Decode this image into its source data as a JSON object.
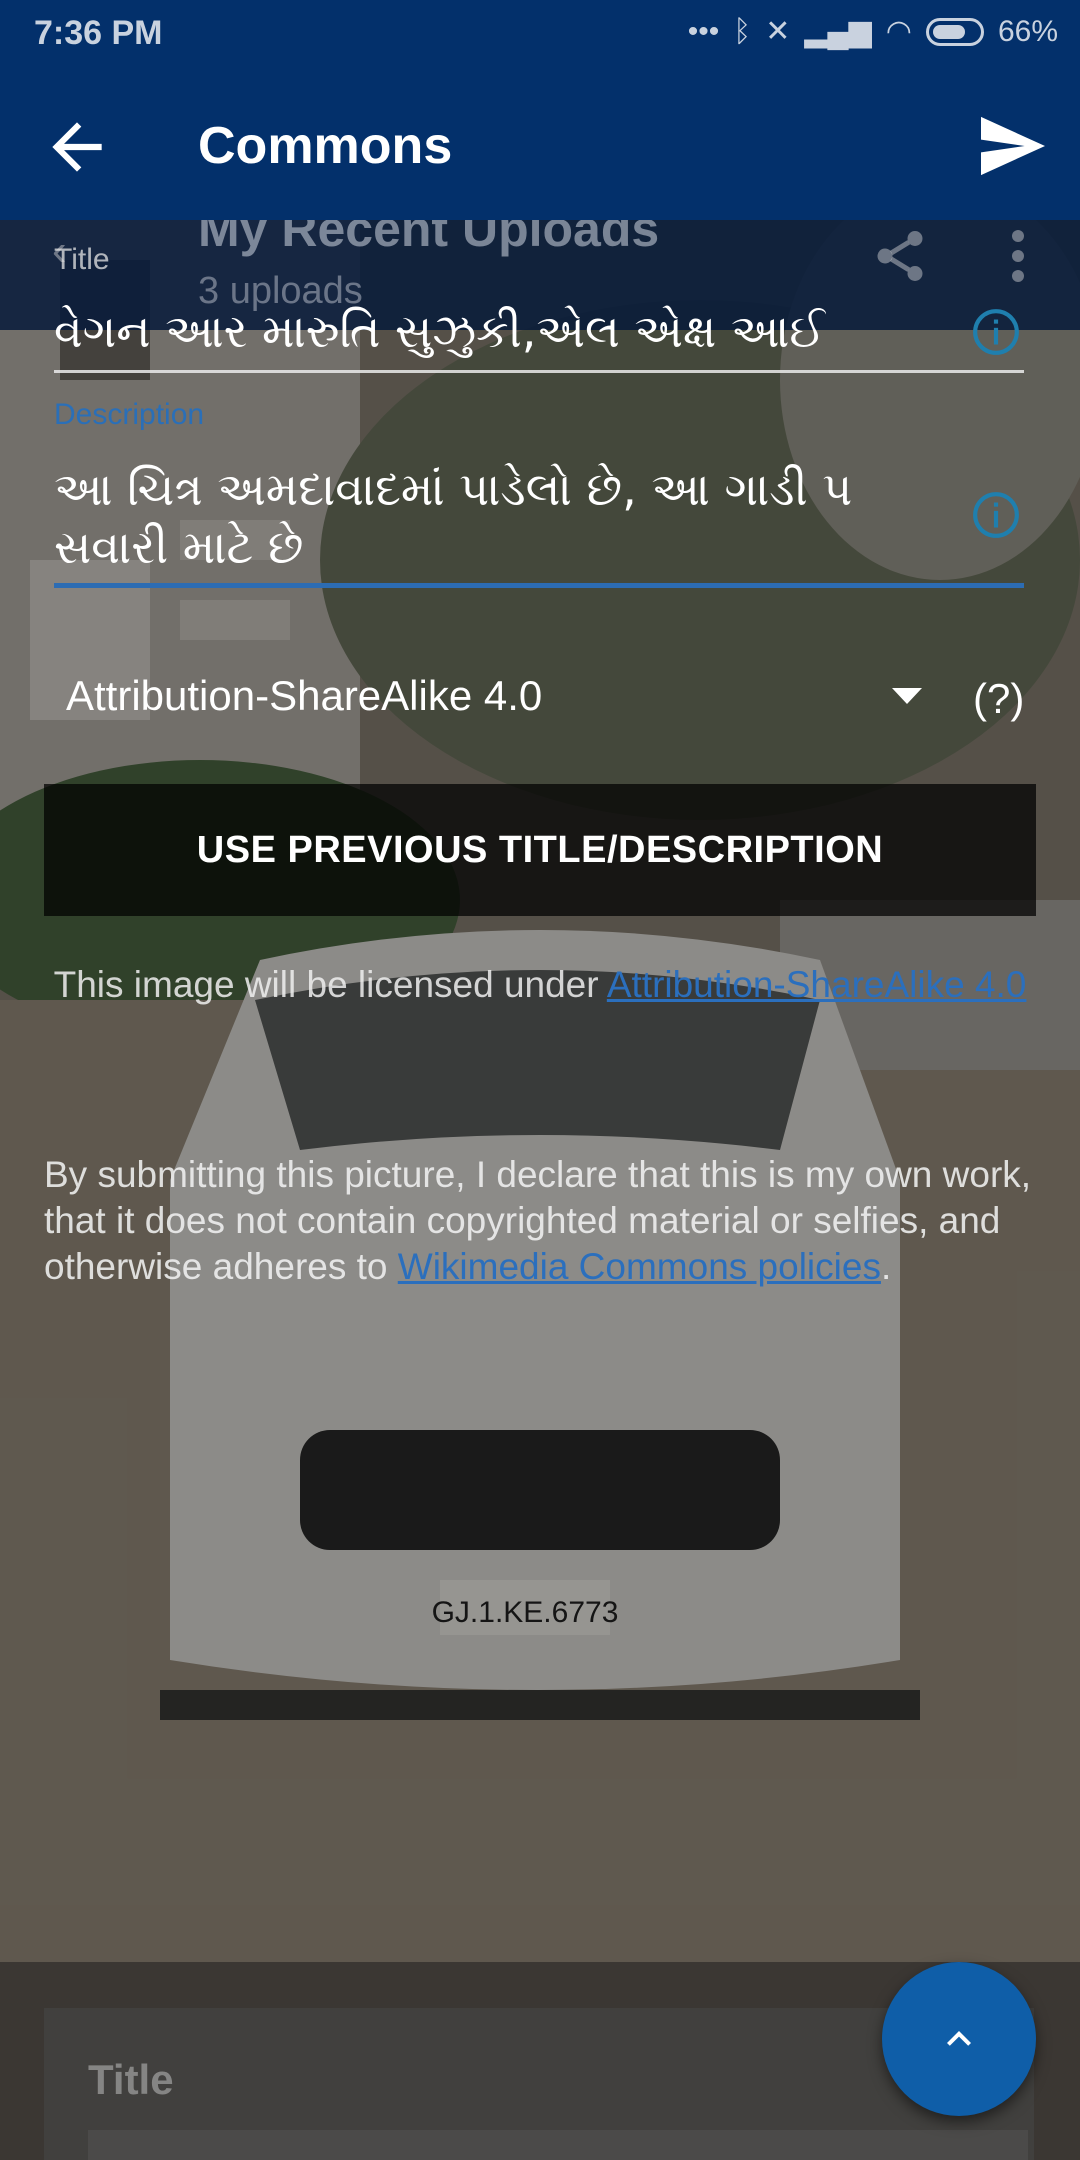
{
  "status_bar": {
    "time": "7:36 PM",
    "battery": "66%"
  },
  "toolbar": {
    "title": "Commons"
  },
  "background_screen": {
    "title": "My Recent Uploads",
    "subtitle": "3 uploads",
    "card_title": "Title"
  },
  "form": {
    "title_label": "Title",
    "title_value": "વેગન આર મારુતિ સુઝુકી,એલ એક્ષ આઈ",
    "description_label": "Description",
    "description_value": "આ ચિત્ર અમદાવાદમાં પાડેલો છે, આ ગાડી પ સવારી માટે છે",
    "license_selected": "Attribution-ShareAlike 4.0",
    "help_label": "(?)",
    "use_previous_button": "USE PREVIOUS TITLE/DESCRIPTION",
    "license_notice_prefix": "This image will be licensed under ",
    "license_link": "Attribution-ShareAlike 4.0",
    "declaration_prefix": "By submitting this picture, I declare that this is my own work, that it does not contain copyrighted material or selfies, and otherwise adheres to ",
    "declaration_link": "Wikimedia Commons policies",
    "declaration_suffix": "."
  },
  "icons": {
    "back": "arrow-left-icon",
    "send": "send-icon",
    "info": "info-icon",
    "dropdown": "triangle-down-icon",
    "fab": "chevron-up-icon"
  },
  "colors": {
    "toolbar": "#03306b",
    "accent": "#2c6cb3",
    "fab": "#0f5ea8"
  }
}
